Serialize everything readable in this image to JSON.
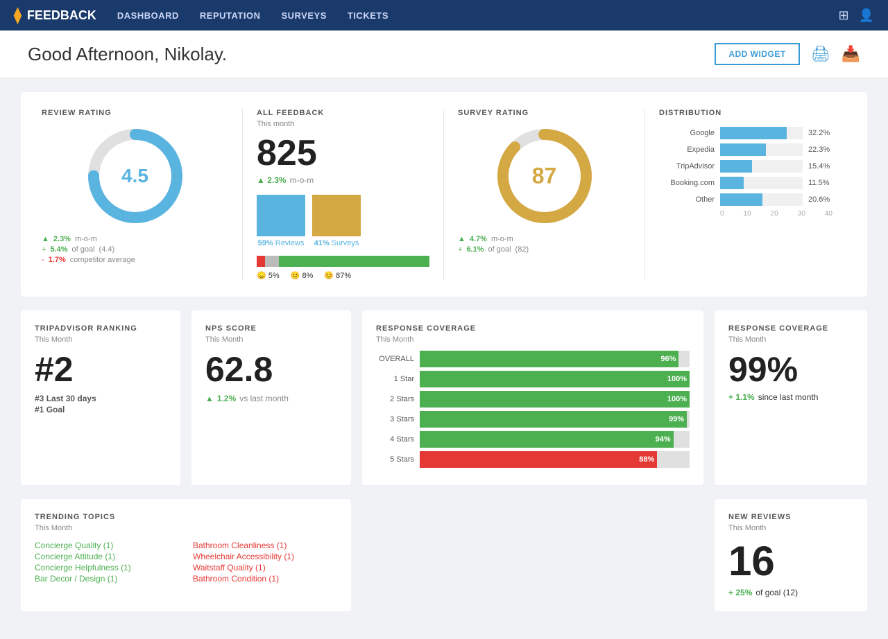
{
  "nav": {
    "brand": "FEEDBACK",
    "logo": "⧫",
    "links": [
      "DASHBOARD",
      "REPUTATION",
      "SURVEYS",
      "TICKETS"
    ]
  },
  "header": {
    "greeting": "Good Afternoon, Nikolay.",
    "add_widget": "ADD WIDGET"
  },
  "review_rating": {
    "title": "REVIEW RATING",
    "score": "4.5",
    "mom": "2.3%",
    "goal_pct": "5.4%",
    "goal_val": "(4.4)",
    "competitor": "1.7%",
    "donut_value": 75
  },
  "all_feedback": {
    "title": "ALL FEEDBACK",
    "subtitle": "This month",
    "total": "825",
    "change_pct": "2.3%",
    "change_label": "m-o-m",
    "reviews_pct": "59%",
    "reviews_label": "Reviews",
    "surveys_pct": "41%",
    "surveys_label": "Surveys",
    "neg_pct": 5,
    "neu_pct": 8,
    "pos_pct": 87,
    "neg_label": "5%",
    "neu_label": "8%",
    "pos_label": "87%"
  },
  "survey_rating": {
    "title": "SURVEY RATING",
    "score": "87",
    "mom": "4.7%",
    "goal_pct": "6.1%",
    "goal_val": "(82)",
    "donut_value": 87
  },
  "distribution": {
    "title": "DISTRIBUTION",
    "items": [
      {
        "label": "Google",
        "value": 32.2,
        "pct": "32.2%",
        "max": 40
      },
      {
        "label": "Expedia",
        "value": 22.3,
        "pct": "22.3%",
        "max": 40
      },
      {
        "label": "TripAdvisor",
        "value": 15.4,
        "pct": "15.4%",
        "max": 40
      },
      {
        "label": "Booking.com",
        "value": 11.5,
        "pct": "11.5%",
        "max": 40
      },
      {
        "label": "Other",
        "value": 20.6,
        "pct": "20.6%",
        "max": 40
      }
    ],
    "axis": [
      "0",
      "10",
      "20",
      "30",
      "40"
    ]
  },
  "tripadvisor": {
    "title": "TRIPADVISOR RANKING",
    "subtitle": "This Month",
    "rank": "#2",
    "last30": "#3",
    "last30_label": "Last 30 days",
    "goal": "#1",
    "goal_label": "Goal"
  },
  "nps": {
    "title": "NPS SCORE",
    "subtitle": "This Month",
    "score": "62.8",
    "change_pct": "1.2%",
    "change_label": "vs last month"
  },
  "response_coverage": {
    "title": "RESPONSE COVERAGE",
    "subtitle": "This Month",
    "bars": [
      {
        "label": "OVERALL",
        "pct": 96,
        "display": "96%",
        "red": false
      },
      {
        "label": "1 Star",
        "pct": 100,
        "display": "100%",
        "red": false
      },
      {
        "label": "2 Stars",
        "pct": 100,
        "display": "100%",
        "red": false
      },
      {
        "label": "3 Stars",
        "pct": 99,
        "display": "99%",
        "red": false
      },
      {
        "label": "4 Stars",
        "pct": 94,
        "display": "94%",
        "red": false
      },
      {
        "label": "5 Stars",
        "pct": 88,
        "display": "88%",
        "red": true
      }
    ]
  },
  "response_coverage2": {
    "title": "RESPONSE COVERAGE",
    "subtitle": "This Month",
    "pct": "99%",
    "change_pct": "+ 1.1%",
    "change_label": "since last month"
  },
  "trending": {
    "title": "TRENDING TOPICS",
    "subtitle": "This Month",
    "green_items": [
      "Concierge Quality (1)",
      "Concierge Attitude (1)",
      "Concierge Helpfulness (1)",
      "Bar Decor / Design (1)"
    ],
    "red_items": [
      "Bathroom Cleanliness (1)",
      "Wheelchair Accessibility (1)",
      "Waitstaff Quality (1)",
      "Bathroom Condition (1)"
    ]
  },
  "new_reviews": {
    "title": "NEW REVIEWS",
    "subtitle": "This Month",
    "count": "16",
    "change_pct": "+ 25%",
    "goal_label": "of goal (12)"
  }
}
